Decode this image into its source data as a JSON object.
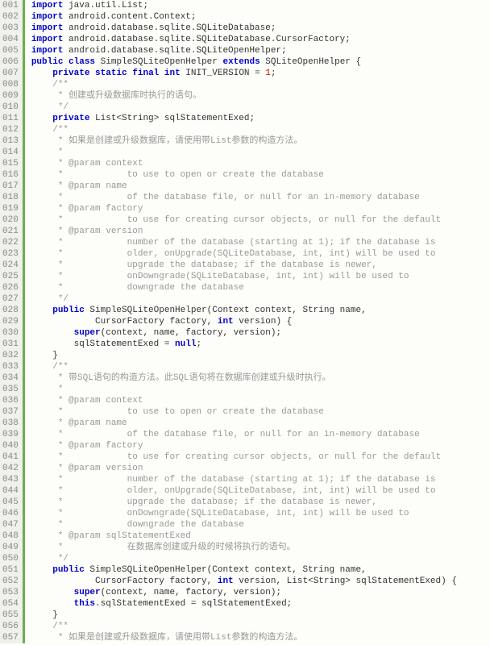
{
  "lines": [
    {
      "n": "001",
      "html": "<span class='kw'>import</span> java.util.List;"
    },
    {
      "n": "002",
      "html": "<span class='kw'>import</span> android.content.Context;"
    },
    {
      "n": "003",
      "html": "<span class='kw'>import</span> android.database.sqlite.SQLiteDatabase;"
    },
    {
      "n": "004",
      "html": "<span class='kw'>import</span> android.database.sqlite.SQLiteDatabase.CursorFactory;"
    },
    {
      "n": "005",
      "html": "<span class='kw'>import</span> android.database.sqlite.SQLiteOpenHelper;"
    },
    {
      "n": "006",
      "html": "<span class='kw'>public</span> <span class='kw'>class</span> SimpleSQLiteOpenHelper <span class='kw'>extends</span> SQLiteOpenHelper {"
    },
    {
      "n": "007",
      "html": "    <span class='kw'>private</span> <span class='kw'>static</span> <span class='kw'>final</span> <span class='kw'>int</span> INIT_VERSION = <span class='num'>1</span>;"
    },
    {
      "n": "008",
      "html": "    <span class='cmt'>/**</span>"
    },
    {
      "n": "009",
      "html": "<span class='cmt'>     * 创建或升级数据库时执行的语句。</span>"
    },
    {
      "n": "010",
      "html": "<span class='cmt'>     */</span>"
    },
    {
      "n": "011",
      "html": "    <span class='kw'>private</span> List&lt;String&gt; sqlStatementExed;"
    },
    {
      "n": "012",
      "html": "    <span class='cmt'>/**</span>"
    },
    {
      "n": "013",
      "html": "<span class='cmt'>     * 如果是创建或升级数据库，请使用带List参数的构造方法。</span>"
    },
    {
      "n": "014",
      "html": "<span class='cmt'>     * </span>"
    },
    {
      "n": "015",
      "html": "<span class='cmt'>     * @param context</span>"
    },
    {
      "n": "016",
      "html": "<span class='cmt'>     *            to use to open or create the database</span>"
    },
    {
      "n": "017",
      "html": "<span class='cmt'>     * @param name</span>"
    },
    {
      "n": "018",
      "html": "<span class='cmt'>     *            of the database file, or null for an in-memory database</span>"
    },
    {
      "n": "019",
      "html": "<span class='cmt'>     * @param factory</span>"
    },
    {
      "n": "020",
      "html": "<span class='cmt'>     *            to use for creating cursor objects, or null for the default</span>"
    },
    {
      "n": "021",
      "html": "<span class='cmt'>     * @param version</span>"
    },
    {
      "n": "022",
      "html": "<span class='cmt'>     *            number of the database (starting at 1); if the database is</span>"
    },
    {
      "n": "023",
      "html": "<span class='cmt'>     *            older, onUpgrade(SQLiteDatabase, int, int) will be used to</span>"
    },
    {
      "n": "024",
      "html": "<span class='cmt'>     *            upgrade the database; if the database is newer,</span>"
    },
    {
      "n": "025",
      "html": "<span class='cmt'>     *            onDowngrade(SQLiteDatabase, int, int) will be used to</span>"
    },
    {
      "n": "026",
      "html": "<span class='cmt'>     *            downgrade the database</span>"
    },
    {
      "n": "027",
      "html": "<span class='cmt'>     */</span>"
    },
    {
      "n": "028",
      "html": "    <span class='kw'>public</span> SimpleSQLiteOpenHelper(Context context, String name,"
    },
    {
      "n": "029",
      "html": "            CursorFactory factory, <span class='kw'>int</span> version) {"
    },
    {
      "n": "030",
      "html": "        <span class='kw'>super</span>(context, name, factory, version);"
    },
    {
      "n": "031",
      "html": "        sqlStatementExed = <span class='kw'>null</span>;"
    },
    {
      "n": "032",
      "html": "    }"
    },
    {
      "n": "033",
      "html": "    <span class='cmt'>/**</span>"
    },
    {
      "n": "034",
      "html": "<span class='cmt'>     * 带SQL语句的构造方法。此SQL语句将在数据库创建或升级时执行。</span>"
    },
    {
      "n": "035",
      "html": "<span class='cmt'>     * </span>"
    },
    {
      "n": "036",
      "html": "<span class='cmt'>     * @param context</span>"
    },
    {
      "n": "037",
      "html": "<span class='cmt'>     *            to use to open or create the database</span>"
    },
    {
      "n": "038",
      "html": "<span class='cmt'>     * @param name</span>"
    },
    {
      "n": "039",
      "html": "<span class='cmt'>     *            of the database file, or null for an in-memory database</span>"
    },
    {
      "n": "040",
      "html": "<span class='cmt'>     * @param factory</span>"
    },
    {
      "n": "041",
      "html": "<span class='cmt'>     *            to use for creating cursor objects, or null for the default</span>"
    },
    {
      "n": "042",
      "html": "<span class='cmt'>     * @param version</span>"
    },
    {
      "n": "043",
      "html": "<span class='cmt'>     *            number of the database (starting at 1); if the database is</span>"
    },
    {
      "n": "044",
      "html": "<span class='cmt'>     *            older, onUpgrade(SQLiteDatabase, int, int) will be used to</span>"
    },
    {
      "n": "045",
      "html": "<span class='cmt'>     *            upgrade the database; if the database is newer,</span>"
    },
    {
      "n": "046",
      "html": "<span class='cmt'>     *            onDowngrade(SQLiteDatabase, int, int) will be used to</span>"
    },
    {
      "n": "047",
      "html": "<span class='cmt'>     *            downgrade the database</span>"
    },
    {
      "n": "048",
      "html": "<span class='cmt'>     * @param sqlStatementExed</span>"
    },
    {
      "n": "049",
      "html": "<span class='cmt'>     *            在数据库创建或升级的时候将执行的语句。</span>"
    },
    {
      "n": "050",
      "html": "<span class='cmt'>     */</span>"
    },
    {
      "n": "051",
      "html": "    <span class='kw'>public</span> SimpleSQLiteOpenHelper(Context context, String name,"
    },
    {
      "n": "052",
      "html": "            CursorFactory factory, <span class='kw'>int</span> version, List&lt;String&gt; sqlStatementExed) {"
    },
    {
      "n": "053",
      "html": "        <span class='kw'>super</span>(context, name, factory, version);"
    },
    {
      "n": "054",
      "html": "        <span class='kw'>this</span>.sqlStatementExed = sqlStatementExed;"
    },
    {
      "n": "055",
      "html": "    }"
    },
    {
      "n": "056",
      "html": "    <span class='cmt'>/**</span>"
    },
    {
      "n": "057",
      "html": "<span class='cmt'>     * 如果是创建或升级数据库，请使用带List参数的构造方法。</span>"
    }
  ]
}
